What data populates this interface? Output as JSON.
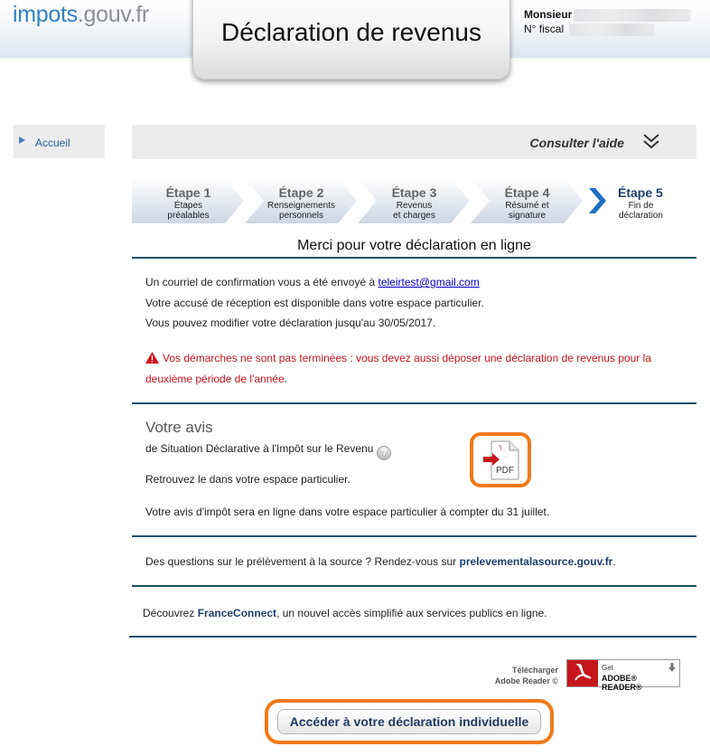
{
  "header": {
    "logo_main": "impots",
    "logo_suffix": ".gouv.fr",
    "title": "Déclaration de revenus",
    "user_name_label": "Monsieur",
    "fiscal_label": "N° fiscal"
  },
  "sidebar": {
    "home_label": "Accueil"
  },
  "help": {
    "label": "Consulter l'aide"
  },
  "steps": [
    {
      "title": "Étape 1",
      "desc1": "Étapes",
      "desc2": "préalables"
    },
    {
      "title": "Étape 2",
      "desc1": "Renseignements",
      "desc2": "personnels"
    },
    {
      "title": "Étape 3",
      "desc1": "Revenus",
      "desc2": "et charges"
    },
    {
      "title": "Étape 4",
      "desc1": "Résumé et",
      "desc2": "signature"
    },
    {
      "title": "Étape 5",
      "desc1": "Fin de",
      "desc2": "déclaration"
    }
  ],
  "confirmation": {
    "title": "Merci pour votre déclaration en ligne",
    "email_text": "Un courriel de confirmation vous a été envoyé à ",
    "email": "teleirtest@gmail.com",
    "receipt_text": "Votre accusé de réception est disponible dans votre espace particulier.",
    "modify_text": "Vous pouvez modifier votre déclaration jusqu'au 30/05/2017.",
    "warning_line1": "Vos démarches ne sont pas terminées : vous devez aussi déposer une déclaration de revenus pour la",
    "warning_line2": "deuxième période de l'année."
  },
  "avis": {
    "title": "Votre avis",
    "subtitle": "de Situation Déclarative à l'Impôt sur le Revenu",
    "help_glyph": "?",
    "find_text": "Retrouvez le dans votre espace particulier.",
    "online_text": "Votre avis d'impôt sera en ligne dans votre espace particulier à compter du 31 juillet.",
    "pdf_label": "PDF"
  },
  "prelevement": {
    "text": "Des questions sur le prélèvement à la source ? Rendez-vous sur ",
    "link": "prelevementalasource.gouv.fr",
    "after": "."
  },
  "franceconnect": {
    "before": "Découvrez ",
    "link": "FranceConnect",
    "after": ", un nouvel accès simplifié aux services publics en ligne."
  },
  "adobe": {
    "line1": "Télécharger",
    "line2": "Adobe Reader ©",
    "badge_get": "Get",
    "badge_name": "ADOBE® READER®"
  },
  "cta": {
    "label": "Accéder à votre déclaration individuelle"
  },
  "colors": {
    "accent_orange": "#f07a1a",
    "rule_blue": "#1c4f6b",
    "warning_red": "#c9141c",
    "link_blue": "#1f3f6e"
  },
  "current_step": 5
}
